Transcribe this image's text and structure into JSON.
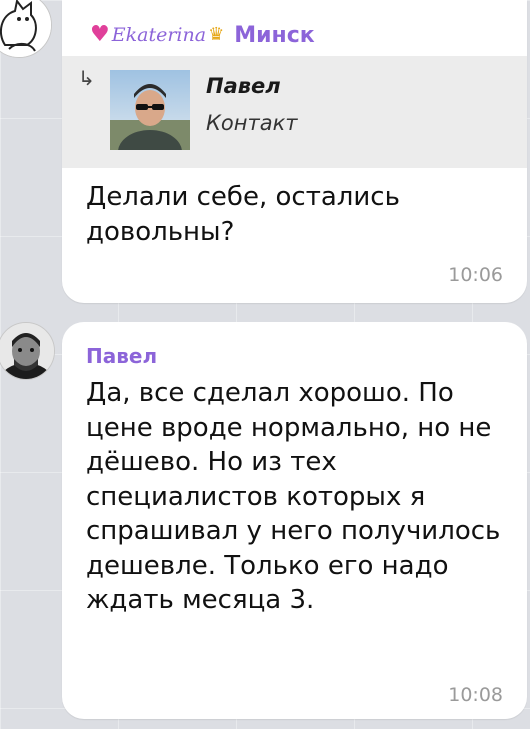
{
  "messages": [
    {
      "sender_name": "Ekaterina",
      "sender_city": "Минск",
      "reply": {
        "name": "Павел",
        "type": "Контакт"
      },
      "text": "Делали себе, остались довольны?",
      "time": "10:06"
    },
    {
      "sender_name": "Павел",
      "text": "Да, все сделал хорошо. По цене вроде нормально, но не дёшево. Но из тех специалистов которых я спрашивал у него получилось дешевле. Только его надо ждать месяца 3.",
      "time": "10:08"
    }
  ],
  "icons": {
    "reply": "reply-arrow-icon",
    "heart": "heart-icon",
    "crown": "crown-icon"
  },
  "colors": {
    "sender_name": "#8c64d9",
    "heart": "#e0409a",
    "bubble": "#ffffff",
    "background": "#dcdee3"
  }
}
